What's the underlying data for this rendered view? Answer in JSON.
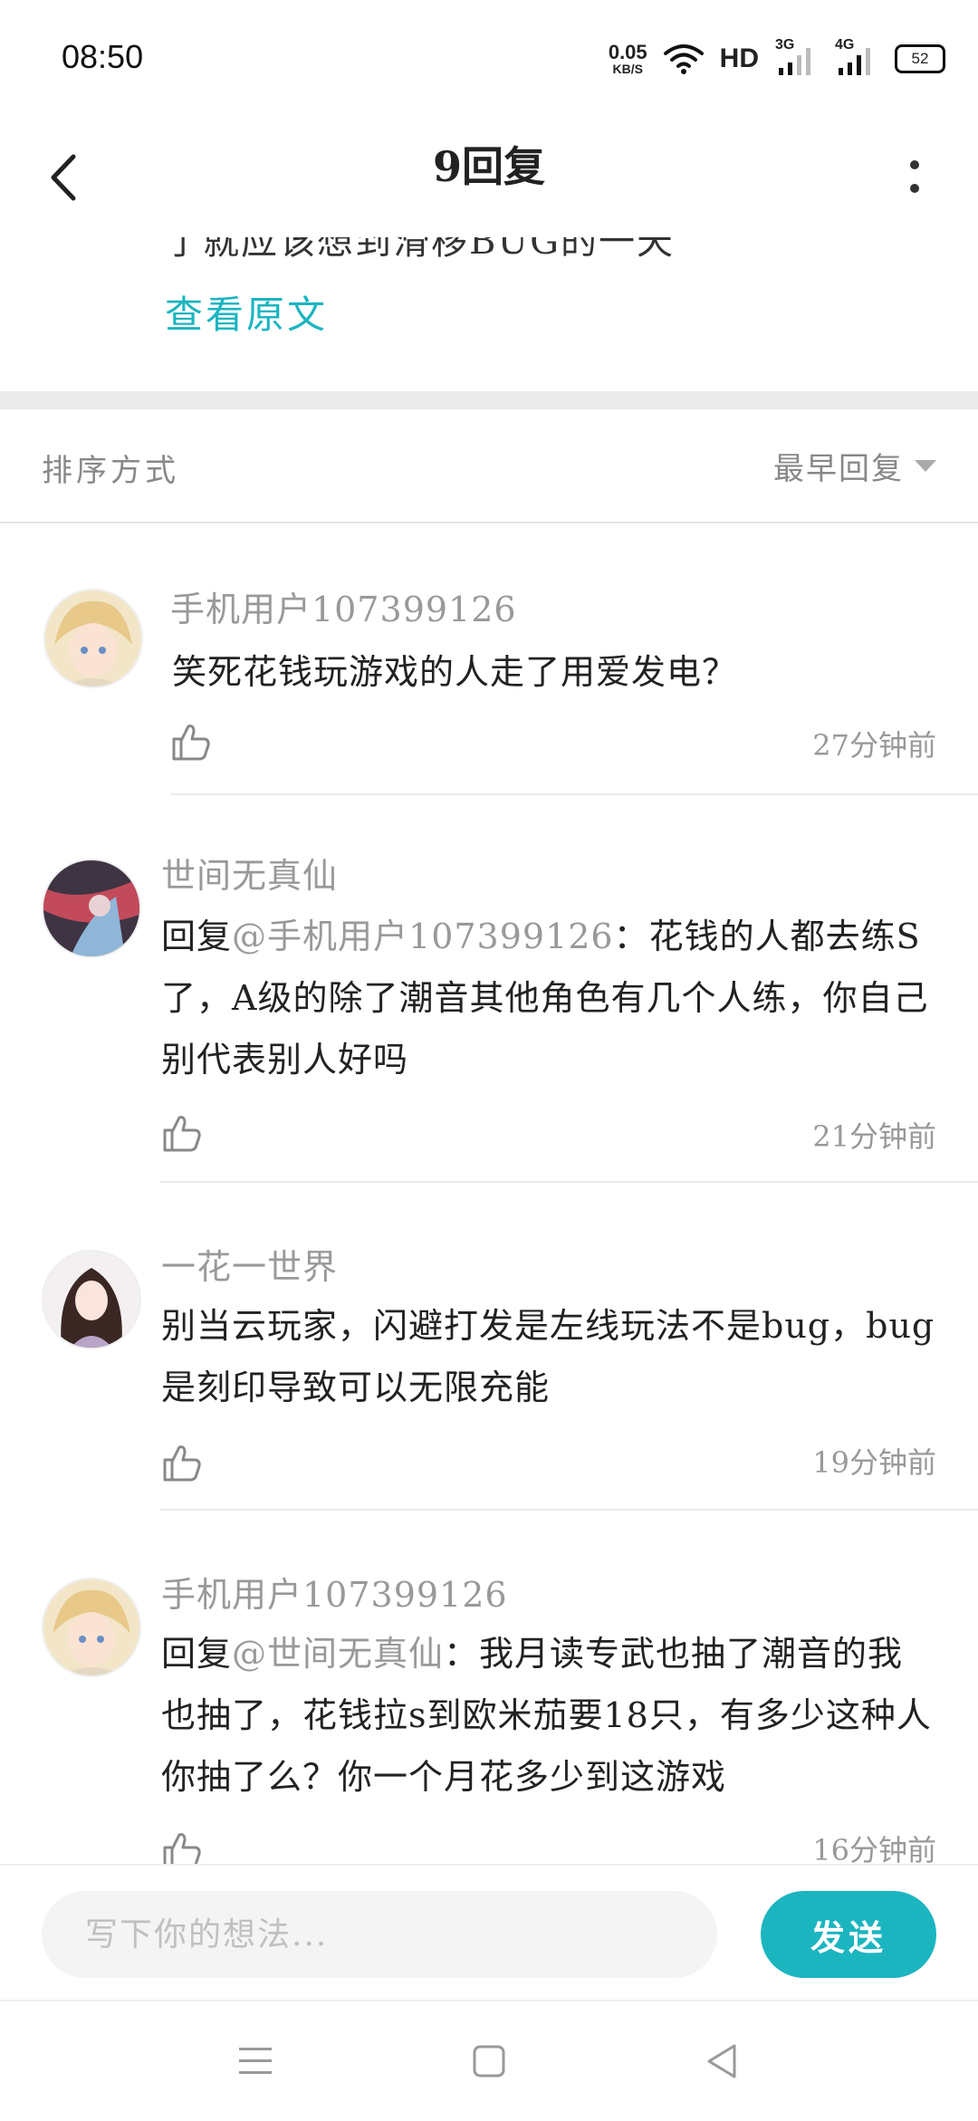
{
  "status": {
    "time": "08:50",
    "net_speed": "0.05",
    "net_unit": "KB/S",
    "hd": "HD",
    "sim1": "3G",
    "sim2": "4G",
    "battery": "52"
  },
  "header": {
    "title": "9回复"
  },
  "original": {
    "cut_text": "了就应该想到滑移BUG的一天",
    "view_label": "查看原文"
  },
  "sort": {
    "label": "排序方式",
    "selected": "最早回复"
  },
  "comments": [
    {
      "user": "手机用户107399126",
      "text": "笑死花钱玩游戏的人走了用爱发电？",
      "time": "27分钟前"
    },
    {
      "user": "世间无真仙",
      "reply_prefix": "回复",
      "reply_to": "@手机用户107399126",
      "reply_sep": "：",
      "text": "花钱的人都去练S了，A级的除了潮音其他角色有几个人练，你自己别代表别人好吗",
      "time": "21分钟前"
    },
    {
      "user": "一花一世界",
      "text": "别当云玩家，闪避打发是左线玩法不是bug，bug是刻印导致可以无限充能",
      "time": "19分钟前"
    },
    {
      "user": "手机用户107399126",
      "reply_prefix": "回复",
      "reply_to": "@世间无真仙",
      "reply_sep": "：",
      "text": "我月读专武也抽了潮音的我也抽了，花钱拉s到欧米茄要18只，有多少这种人你抽了么？你一个月花多少到这游戏",
      "time": "16分钟前"
    }
  ],
  "composer": {
    "placeholder": "写下你的想法...",
    "send_label": "发送"
  },
  "colors": {
    "accent": "#1bb5c0",
    "muted": "#999999"
  }
}
